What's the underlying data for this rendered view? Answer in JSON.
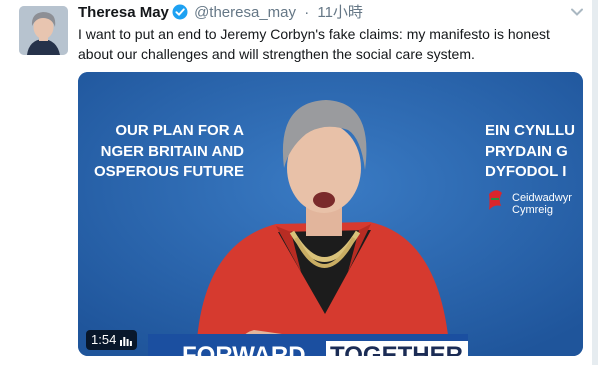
{
  "tweet": {
    "name": "Theresa May",
    "handle": "@theresa_may",
    "separator": "·",
    "time": "11小時",
    "text": "I want to put an end to Jeremy Corbyn's fake claims: my manifesto is honest about our challenges and will strengthen the social care system."
  },
  "media": {
    "duration": "1:54",
    "slogan_left": [
      "OUR PLAN FOR A",
      "NGER BRITAIN AND",
      "OSPEROUS FUTURE"
    ],
    "slogan_right": [
      "EIN CYNLLU",
      "PRYDAIN G",
      "DYFODOL I"
    ],
    "welsh_party": [
      "Ceidwadwyr",
      "Cymreig"
    ],
    "banner": [
      "FORWARD",
      "TOGETHER"
    ]
  },
  "colors": {
    "verified": "#1da1f2",
    "backdrop": "#2a64ad",
    "jacket": "#d63a2f",
    "banner": "#1b4fa0"
  },
  "icons": {
    "verified": "verified-badge-icon",
    "caret": "chevron-down-icon",
    "volume": "audio-bars-icon"
  }
}
